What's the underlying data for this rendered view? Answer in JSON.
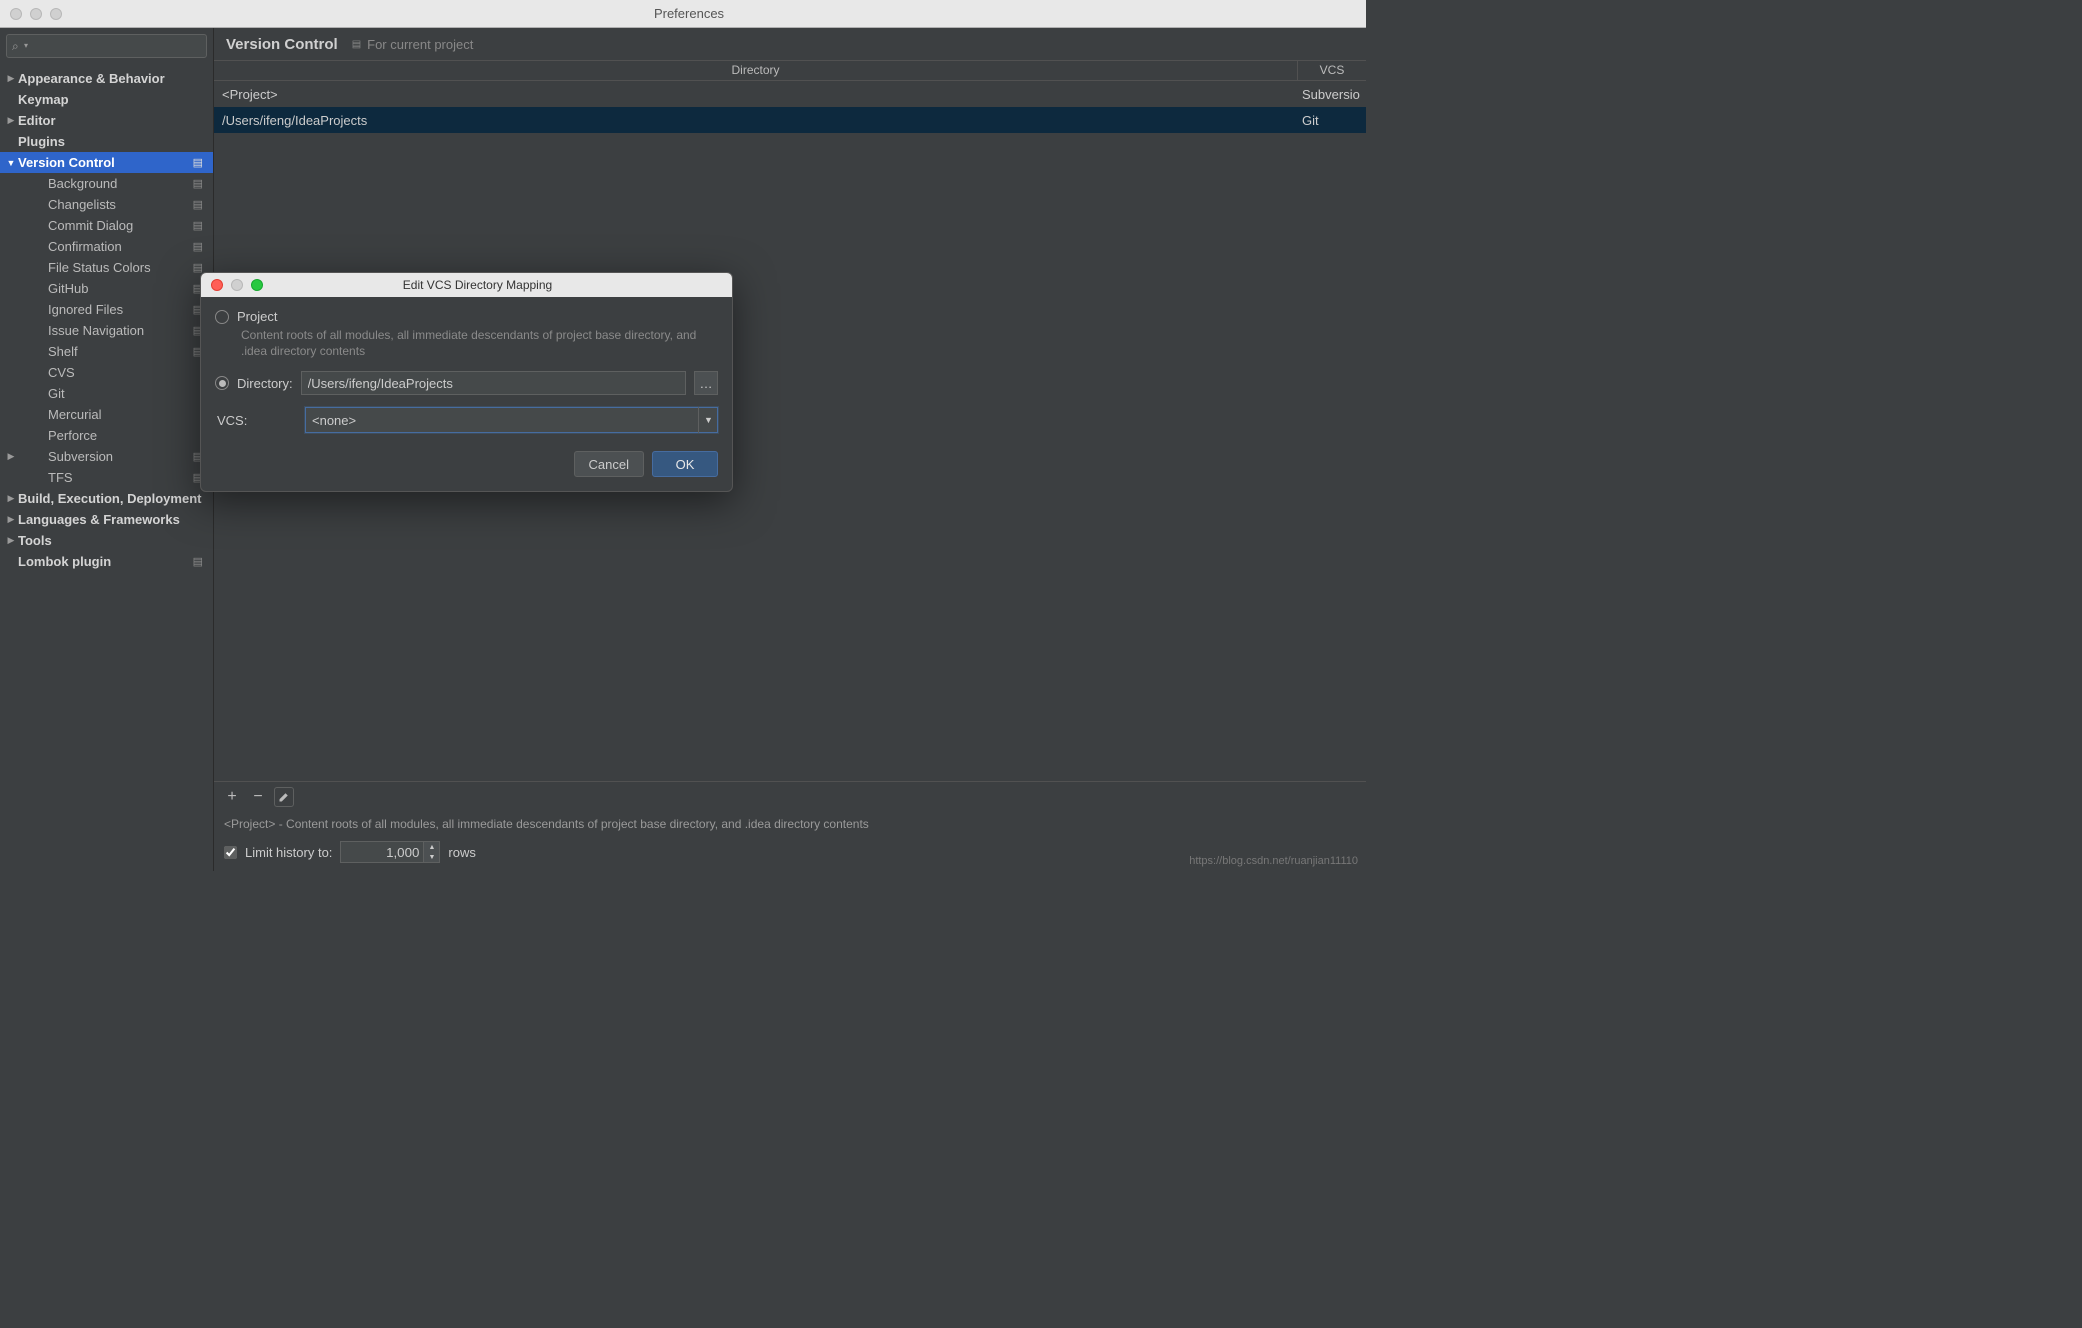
{
  "window": {
    "title": "Preferences"
  },
  "search": {
    "placeholder": ""
  },
  "sidebar": {
    "items": [
      {
        "label": "Appearance & Behavior",
        "bold": true,
        "expandable": true,
        "expanded": false,
        "indent": 0
      },
      {
        "label": "Keymap",
        "bold": true,
        "indent": 0
      },
      {
        "label": "Editor",
        "bold": true,
        "expandable": true,
        "expanded": false,
        "indent": 0
      },
      {
        "label": "Plugins",
        "bold": true,
        "indent": 0
      },
      {
        "label": "Version Control",
        "bold": true,
        "expandable": true,
        "expanded": true,
        "indent": 0,
        "selected": true,
        "projIcon": true
      },
      {
        "label": "Background",
        "indent": 2,
        "projIcon": true
      },
      {
        "label": "Changelists",
        "indent": 2,
        "projIcon": true
      },
      {
        "label": "Commit Dialog",
        "indent": 2,
        "projIcon": true
      },
      {
        "label": "Confirmation",
        "indent": 2,
        "projIcon": true
      },
      {
        "label": "File Status Colors",
        "indent": 2,
        "projIcon": true
      },
      {
        "label": "GitHub",
        "indent": 2,
        "projIcon": true
      },
      {
        "label": "Ignored Files",
        "indent": 2,
        "projIcon": true
      },
      {
        "label": "Issue Navigation",
        "indent": 2,
        "projIcon": true
      },
      {
        "label": "Shelf",
        "indent": 2,
        "projIcon": true
      },
      {
        "label": "CVS",
        "indent": 2
      },
      {
        "label": "Git",
        "indent": 2
      },
      {
        "label": "Mercurial",
        "indent": 2
      },
      {
        "label": "Perforce",
        "indent": 2
      },
      {
        "label": "Subversion",
        "indent": 2,
        "expandable": true,
        "expanded": false,
        "projIcon": true
      },
      {
        "label": "TFS",
        "indent": 2,
        "projIcon": true
      },
      {
        "label": "Build, Execution, Deployment",
        "bold": true,
        "expandable": true,
        "expanded": false,
        "indent": 0
      },
      {
        "label": "Languages & Frameworks",
        "bold": true,
        "expandable": true,
        "expanded": false,
        "indent": 0
      },
      {
        "label": "Tools",
        "bold": true,
        "expandable": true,
        "expanded": false,
        "indent": 0
      },
      {
        "label": "Lombok plugin",
        "bold": true,
        "indent": 0,
        "projIcon": true
      }
    ]
  },
  "breadcrumb": {
    "title": "Version Control",
    "badge": "For current project"
  },
  "table": {
    "headers": {
      "dir": "Directory",
      "vcs": "VCS"
    },
    "rows": [
      {
        "dir": "<Project>",
        "vcs": "Subversio",
        "selected": false
      },
      {
        "dir": "/Users/ifeng/IdeaProjects",
        "vcs": "Git",
        "selected": true
      }
    ]
  },
  "toolbar": {
    "add": "+",
    "remove": "−",
    "edit_icon": "pencil"
  },
  "help_text": "<Project> - Content roots of all modules, all immediate descendants of project base directory, and .idea directory contents",
  "limit": {
    "label": "Limit history to:",
    "value": "1,000",
    "suffix": "rows",
    "checked": true
  },
  "modal": {
    "title": "Edit VCS Directory Mapping",
    "project_label": "Project",
    "project_desc": "Content roots of all modules, all immediate descendants of project base directory, and .idea directory contents",
    "directory_label": "Directory:",
    "directory_value": "/Users/ifeng/IdeaProjects",
    "vcs_label": "VCS:",
    "vcs_value": "<none>",
    "cancel": "Cancel",
    "ok": "OK"
  },
  "watermark": "https://blog.csdn.net/ruanjian11110"
}
